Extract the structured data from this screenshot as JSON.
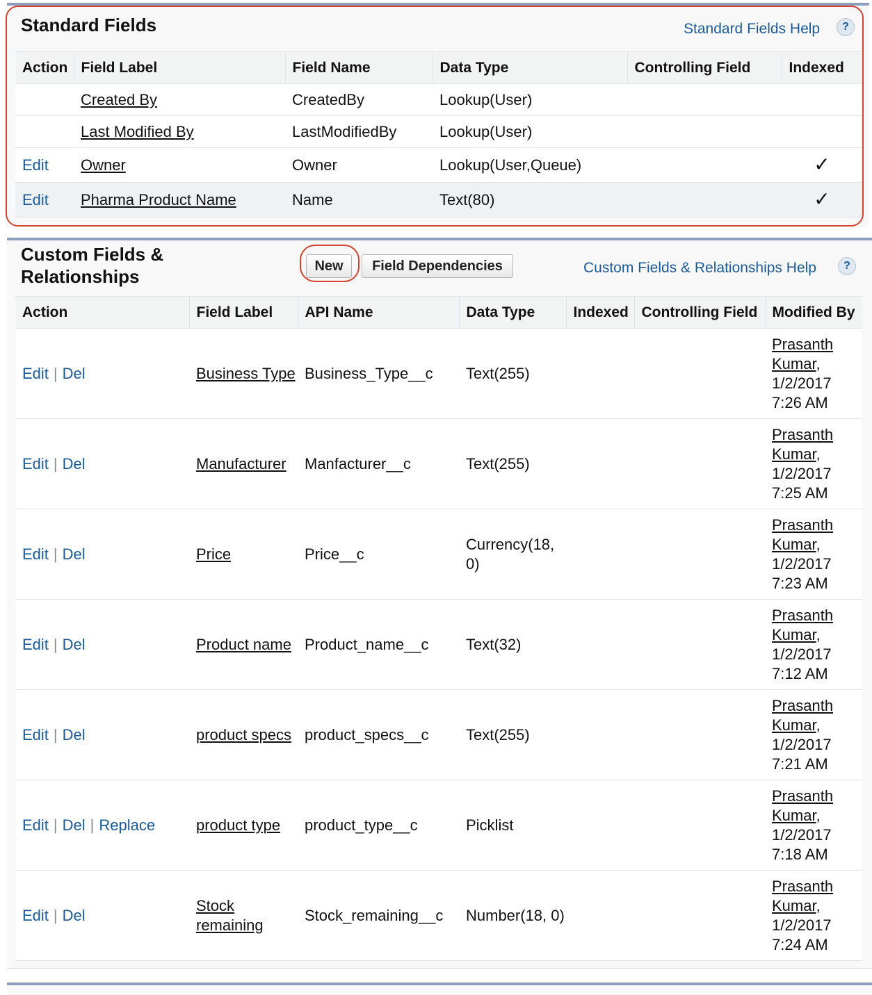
{
  "standard": {
    "title": "Standard Fields",
    "help_label": "Standard Fields Help",
    "help_icon": "?",
    "columns": [
      "Action",
      "Field Label",
      "Field Name",
      "Data Type",
      "Controlling Field",
      "Indexed"
    ],
    "rows": [
      {
        "action": "",
        "label": "Created By",
        "name": "CreatedBy",
        "type": "Lookup(User)",
        "controlling": "",
        "indexed": ""
      },
      {
        "action": "",
        "label": "Last Modified By",
        "name": "LastModifiedBy",
        "type": "Lookup(User)",
        "controlling": "",
        "indexed": ""
      },
      {
        "action": "Edit",
        "label": "Owner",
        "name": "Owner",
        "type": "Lookup(User,Queue)",
        "controlling": "",
        "indexed": "✓"
      },
      {
        "action": "Edit",
        "label": "Pharma Product Name",
        "name": "Name",
        "type": "Text(80)",
        "controlling": "",
        "indexed": "✓"
      }
    ]
  },
  "custom": {
    "title_line1": "Custom Fields &",
    "title_line2": "Relationships",
    "new_button": "New",
    "deps_button": "Field Dependencies",
    "help_label": "Custom Fields & Relationships Help",
    "help_icon": "?",
    "columns": [
      "Action",
      "Field Label",
      "API Name",
      "Data Type",
      "Indexed",
      "Controlling Field",
      "Modified By"
    ],
    "action_edit": "Edit",
    "action_del": "Del",
    "action_replace": "Replace",
    "separator": "|",
    "rows": [
      {
        "label": "Business Type",
        "api": "Business_Type__c",
        "type": "Text(255)",
        "indexed": "",
        "controlling": "",
        "modified_user": "Prasanth Kumar",
        "modified_date": "1/2/2017 7:26 AM",
        "replace": false
      },
      {
        "label": "Manufacturer",
        "api": "Manfacturer__c",
        "type": "Text(255)",
        "indexed": "",
        "controlling": "",
        "modified_user": "Prasanth Kumar",
        "modified_date": "1/2/2017 7:25 AM",
        "replace": false
      },
      {
        "label": "Price",
        "api": "Price__c",
        "type": "Currency(18, 0)",
        "indexed": "",
        "controlling": "",
        "modified_user": "Prasanth Kumar",
        "modified_date": "1/2/2017 7:23 AM",
        "replace": false
      },
      {
        "label": "Product name",
        "api": "Product_name__c",
        "type": "Text(32)",
        "indexed": "",
        "controlling": "",
        "modified_user": "Prasanth Kumar",
        "modified_date": "1/2/2017 7:12 AM",
        "replace": false
      },
      {
        "label": "product specs",
        "api": "product_specs__c",
        "type": "Text(255)",
        "indexed": "",
        "controlling": "",
        "modified_user": "Prasanth Kumar",
        "modified_date": "1/2/2017 7:21 AM",
        "replace": false
      },
      {
        "label": "product type",
        "api": "product_type__c",
        "type": "Picklist",
        "indexed": "",
        "controlling": "",
        "modified_user": "Prasanth Kumar",
        "modified_date": "1/2/2017 7:18 AM",
        "replace": true
      },
      {
        "label": "Stock remaining",
        "api": "Stock_remaining__c",
        "type": "Number(18, 0)",
        "indexed": "",
        "controlling": "",
        "modified_user": "Prasanth Kumar",
        "modified_date": "1/2/2017 7:24 AM",
        "replace": false
      }
    ]
  },
  "colors": {
    "link": "#1a5a96",
    "header_bar": "#8e9dbe",
    "annotation": "#d4432e"
  }
}
